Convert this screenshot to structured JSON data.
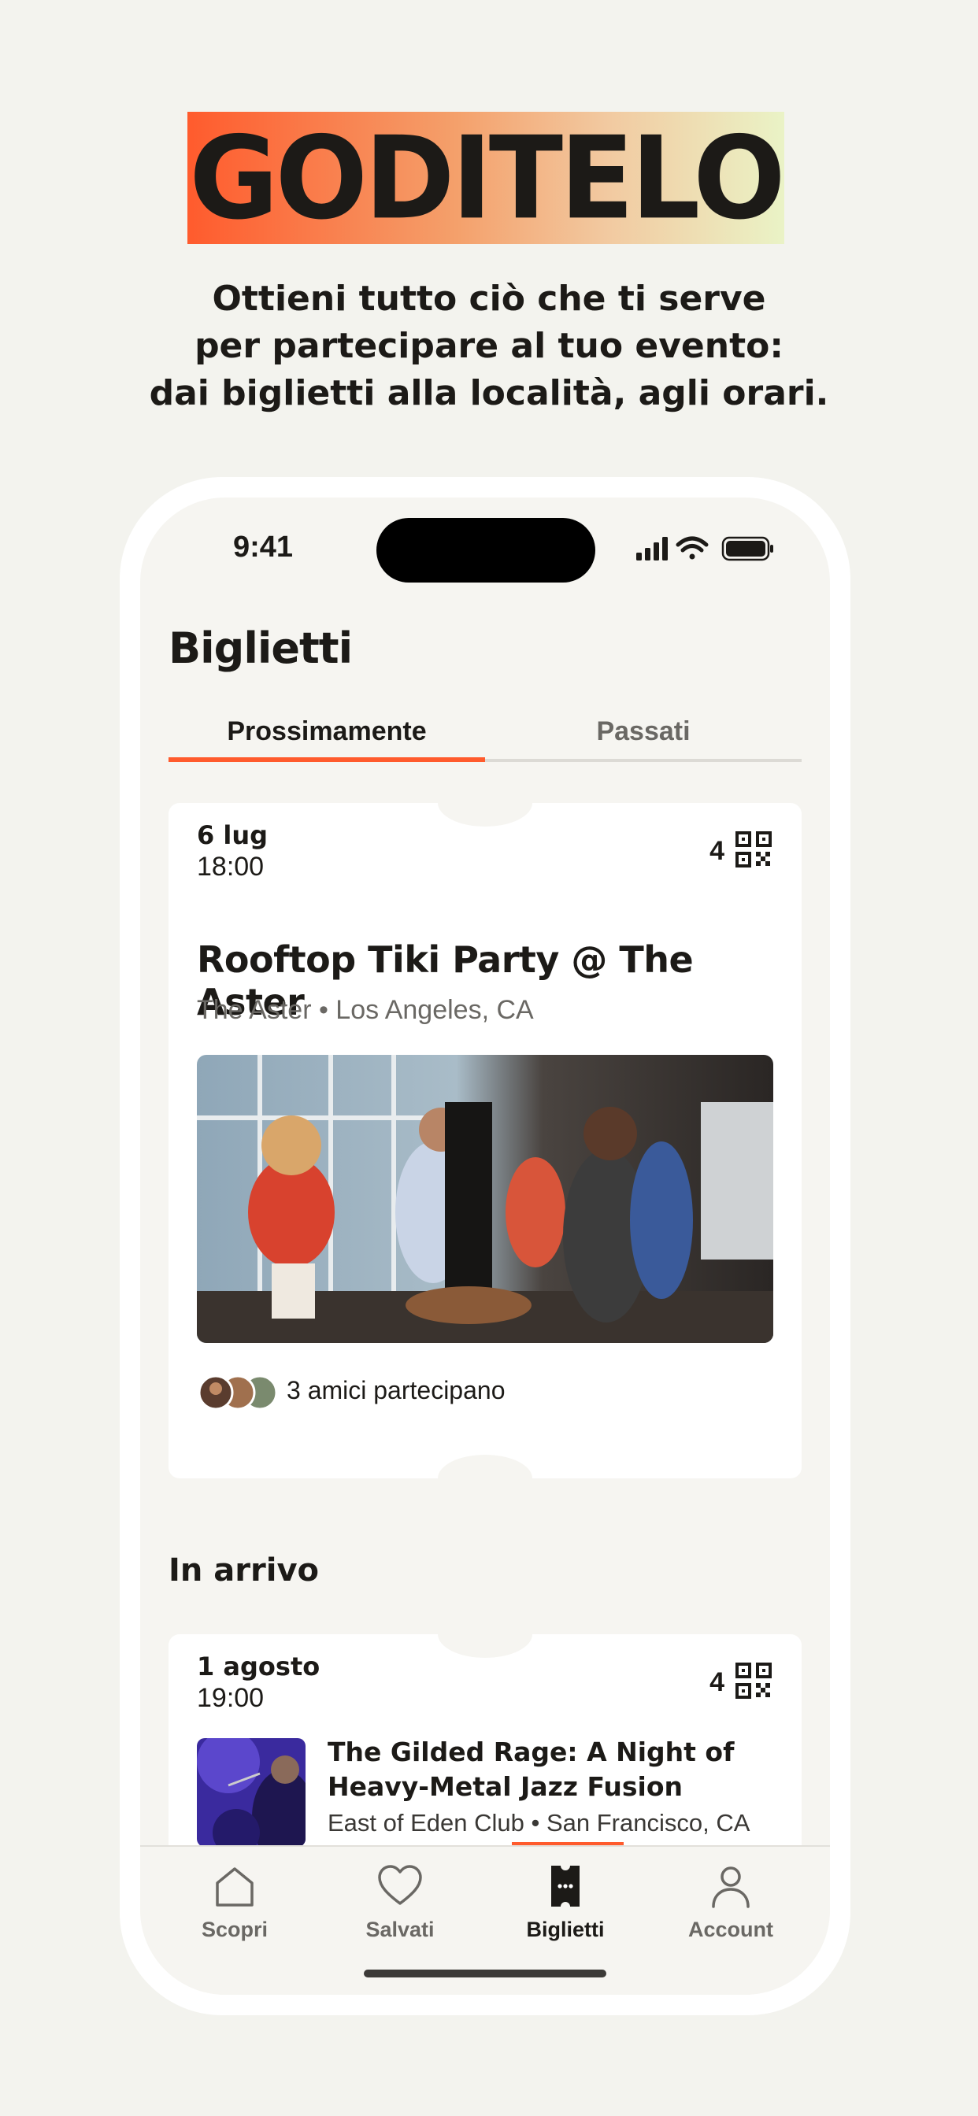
{
  "hero": {
    "title": "GODITELO",
    "subtitle_lines": [
      "Ottieni tutto ciò che ti serve",
      "per partecipare al tuo evento:",
      "dai biglietti alla località, agli orari."
    ]
  },
  "status_bar": {
    "time": "9:41",
    "icons": [
      "signal-icon",
      "wifi-icon",
      "battery-icon"
    ]
  },
  "page": {
    "title": "Biglietti",
    "tabs": [
      {
        "label": "Prossimamente",
        "active": true
      },
      {
        "label": "Passati",
        "active": false
      }
    ]
  },
  "tickets": [
    {
      "date": "6 lug",
      "time": "18:00",
      "count": "4",
      "title": "Rooftop Tiki Party @ The Aster",
      "venue": "The Aster • Los Angeles, CA",
      "friends": "3 amici partecipano"
    }
  ],
  "section": {
    "heading": "In arrivo"
  },
  "upcoming": [
    {
      "date": "1 agosto",
      "time": "19:00",
      "count": "4",
      "title": "The Gilded Rage: A Night of Heavy-Metal Jazz Fusion",
      "venue": "East of Eden Club • San Francisco, CA"
    }
  ],
  "nav": [
    {
      "label": "Scopri",
      "icon": "home-icon",
      "active": false
    },
    {
      "label": "Salvati",
      "icon": "heart-icon",
      "active": false
    },
    {
      "label": "Biglietti",
      "icon": "ticket-icon",
      "active": true
    },
    {
      "label": "Account",
      "icon": "person-icon",
      "active": false
    }
  ],
  "colors": {
    "accent": "#ff5b2d",
    "background": "#f3f3ee",
    "text": "#1c1a17",
    "muted": "#6a6864"
  }
}
